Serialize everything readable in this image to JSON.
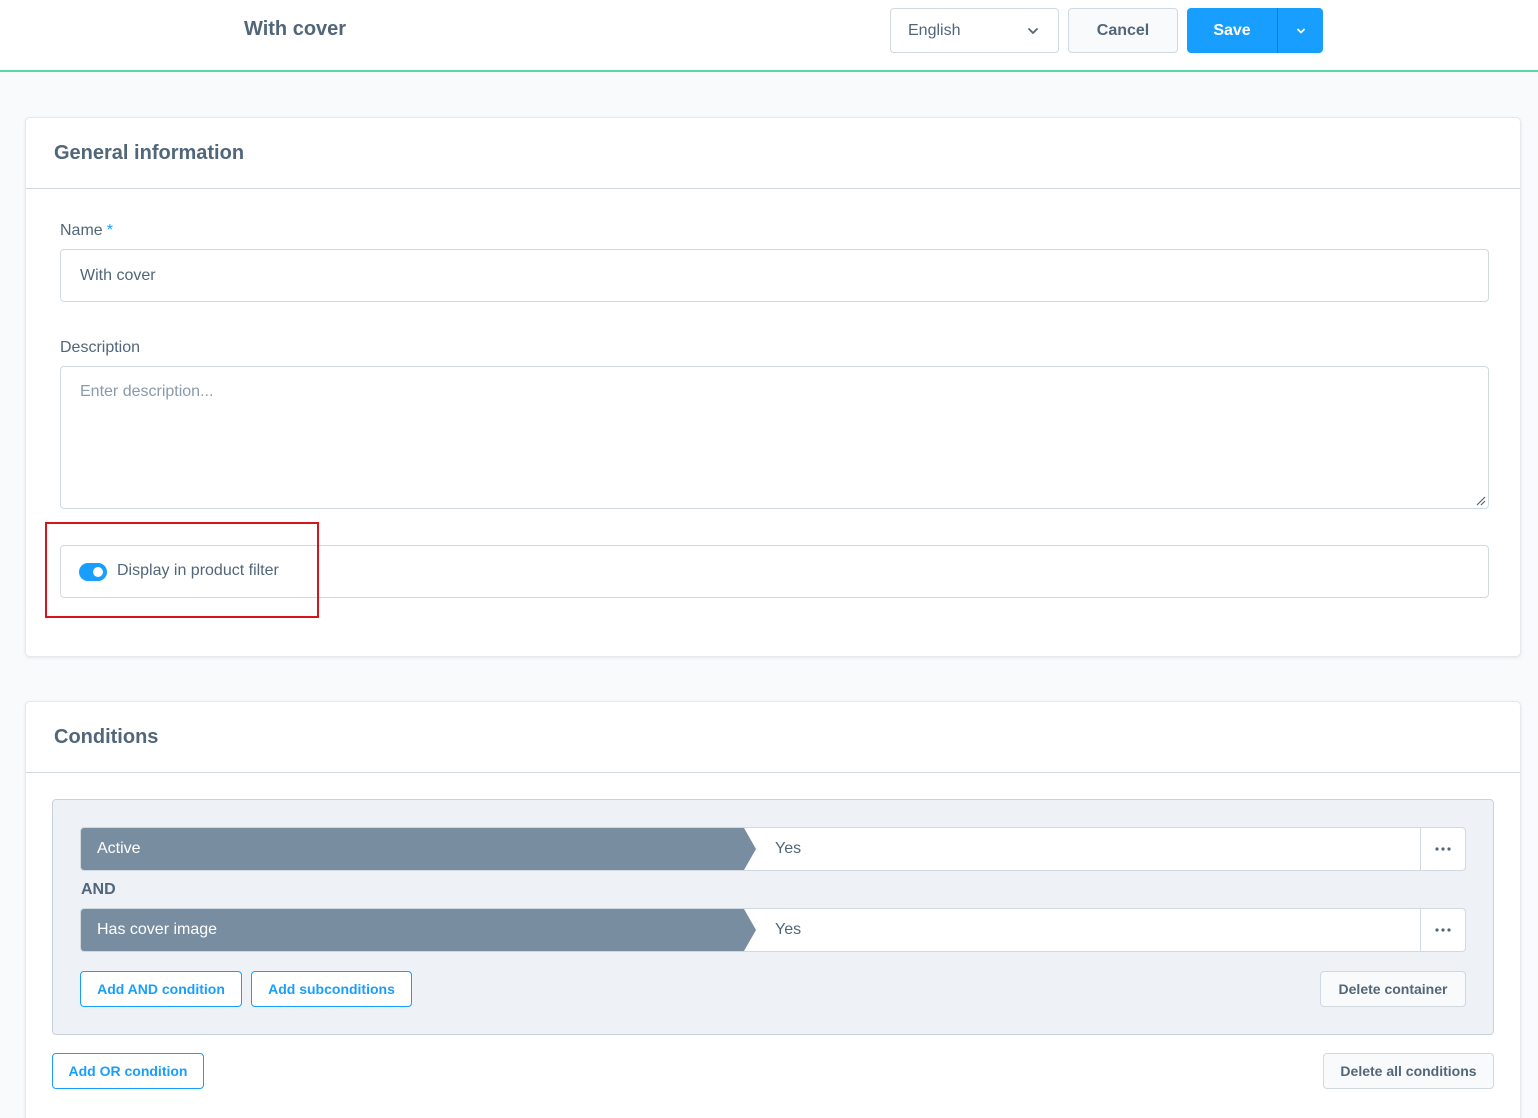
{
  "header": {
    "title": "With cover",
    "language": "English",
    "cancel_label": "Cancel",
    "save_label": "Save"
  },
  "general": {
    "title": "General information",
    "name_label": "Name",
    "name_required": "*",
    "name_value": "With cover",
    "description_label": "Description",
    "description_placeholder": "Enter description...",
    "display_filter_label": "Display in product filter",
    "display_filter_on": true
  },
  "conditions": {
    "title": "Conditions",
    "rows": [
      {
        "field": "Active",
        "value": "Yes"
      },
      {
        "field": "Has cover image",
        "value": "Yes"
      }
    ],
    "operator": "AND",
    "add_and_label": "Add AND condition",
    "add_sub_label": "Add subconditions",
    "delete_container_label": "Delete container",
    "add_or_label": "Add OR condition",
    "delete_all_label": "Delete all conditions"
  },
  "colors": {
    "accent": "#189eff",
    "header_border": "#57d9a3",
    "condition_field_bg": "#798da1",
    "highlight": "#d8141b"
  }
}
